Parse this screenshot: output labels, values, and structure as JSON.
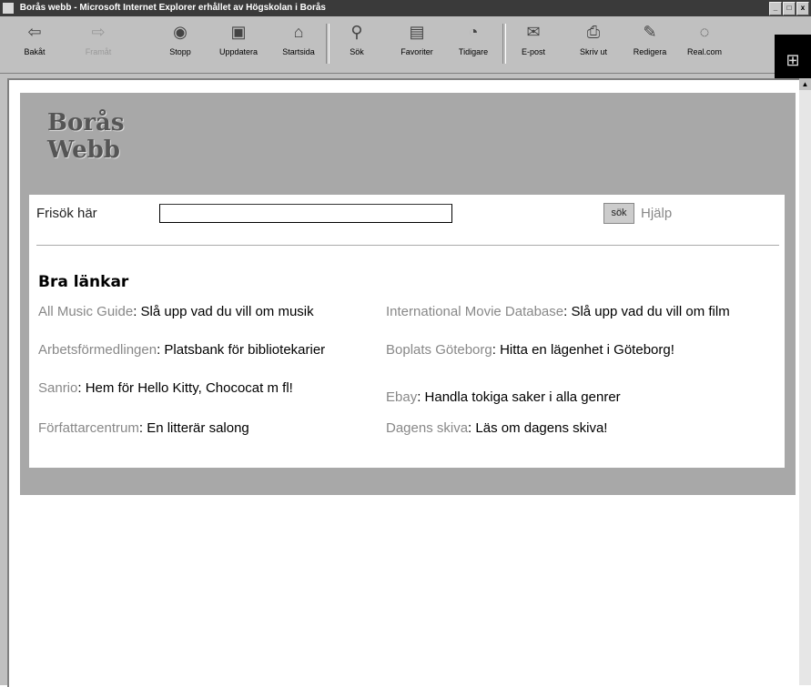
{
  "window": {
    "title": "Borås webb - Microsoft Internet Explorer erhållet av Högskolan i Borås"
  },
  "toolbar": {
    "buttons": [
      {
        "label": "Bakåt",
        "icon": "back-arrow-icon"
      },
      {
        "label": "Framåt",
        "icon": "forward-arrow-icon"
      },
      {
        "label": "Stopp",
        "icon": "stop-icon"
      },
      {
        "label": "Uppdatera",
        "icon": "refresh-icon"
      },
      {
        "label": "Startsida",
        "icon": "home-icon"
      },
      {
        "label": "Sök",
        "icon": "search-icon"
      },
      {
        "label": "Favoriter",
        "icon": "favorites-icon"
      },
      {
        "label": "Tidigare",
        "icon": "history-icon"
      },
      {
        "label": "E-post",
        "icon": "mail-icon"
      },
      {
        "label": "Skriv ut",
        "icon": "print-icon"
      },
      {
        "label": "Redigera",
        "icon": "edit-icon"
      },
      {
        "label": "Real.com",
        "icon": "real-icon"
      }
    ]
  },
  "page": {
    "logo": {
      "line1": "Borås",
      "line2": "Webb"
    },
    "search": {
      "label": "Frisök här",
      "button": "sök",
      "help": "Hjälp",
      "value": ""
    },
    "links_title": "Bra länkar",
    "links": [
      {
        "name": "All Music Guide",
        "desc": ": Slå upp vad du vill om musik"
      },
      {
        "name": "International Movie Database",
        "desc": ": Slå upp vad du vill om film"
      },
      {
        "name": "Arbetsförmedlingen",
        "desc": ": Platsbank för bibliotekarier"
      },
      {
        "name": "Boplats Göteborg",
        "desc": ": Hitta en lägenhet i Göteborg!"
      },
      {
        "name": "Sanrio",
        "desc": ": Hem för Hello Kitty, Chococat m fl!"
      },
      {
        "name": "Ebay",
        "desc": ": Handla tokiga saker i alla genrer"
      },
      {
        "name": "Författarcentrum",
        "desc": ": En litterär salong"
      },
      {
        "name": "Dagens skiva",
        "desc": ": Läs om dagens skiva!"
      }
    ]
  }
}
